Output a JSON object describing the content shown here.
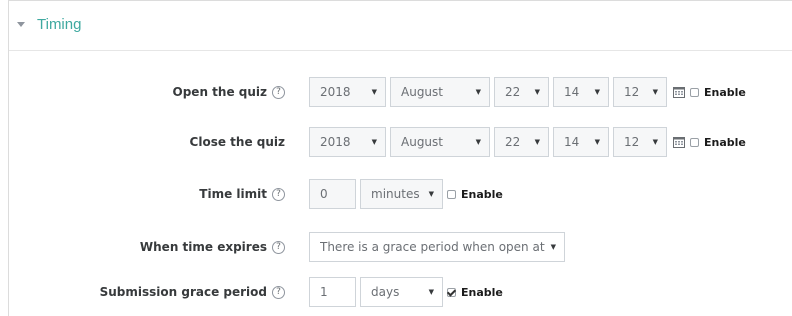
{
  "section": {
    "title": "Timing"
  },
  "open_quiz": {
    "label": "Open the quiz",
    "year": "2018",
    "month": "August",
    "day": "22",
    "hour": "14",
    "minute": "12",
    "enable_label": "Enable",
    "enabled": false
  },
  "close_quiz": {
    "label": "Close the quiz",
    "year": "2018",
    "month": "August",
    "day": "22",
    "hour": "14",
    "minute": "12",
    "enable_label": "Enable",
    "enabled": false
  },
  "time_limit": {
    "label": "Time limit",
    "value": "0",
    "unit": "minutes",
    "enable_label": "Enable",
    "enabled": false
  },
  "when_expires": {
    "label": "When time expires",
    "value": "There is a grace period when open atte"
  },
  "grace_period": {
    "label": "Submission grace period",
    "value": "1",
    "unit": "days",
    "enable_label": "Enable",
    "enabled": true
  },
  "icons": {
    "help": "?",
    "calendar": "calendar-icon",
    "dropdown": "▼"
  }
}
